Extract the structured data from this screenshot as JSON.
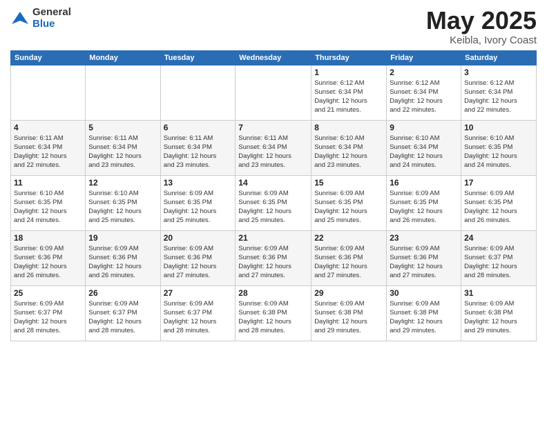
{
  "logo": {
    "general": "General",
    "blue": "Blue"
  },
  "header": {
    "month": "May 2025",
    "location": "Keibla, Ivory Coast"
  },
  "weekdays": [
    "Sunday",
    "Monday",
    "Tuesday",
    "Wednesday",
    "Thursday",
    "Friday",
    "Saturday"
  ],
  "weeks": [
    [
      {
        "day": "",
        "info": ""
      },
      {
        "day": "",
        "info": ""
      },
      {
        "day": "",
        "info": ""
      },
      {
        "day": "",
        "info": ""
      },
      {
        "day": "1",
        "info": "Sunrise: 6:12 AM\nSunset: 6:34 PM\nDaylight: 12 hours\nand 21 minutes."
      },
      {
        "day": "2",
        "info": "Sunrise: 6:12 AM\nSunset: 6:34 PM\nDaylight: 12 hours\nand 22 minutes."
      },
      {
        "day": "3",
        "info": "Sunrise: 6:12 AM\nSunset: 6:34 PM\nDaylight: 12 hours\nand 22 minutes."
      }
    ],
    [
      {
        "day": "4",
        "info": "Sunrise: 6:11 AM\nSunset: 6:34 PM\nDaylight: 12 hours\nand 22 minutes."
      },
      {
        "day": "5",
        "info": "Sunrise: 6:11 AM\nSunset: 6:34 PM\nDaylight: 12 hours\nand 23 minutes."
      },
      {
        "day": "6",
        "info": "Sunrise: 6:11 AM\nSunset: 6:34 PM\nDaylight: 12 hours\nand 23 minutes."
      },
      {
        "day": "7",
        "info": "Sunrise: 6:11 AM\nSunset: 6:34 PM\nDaylight: 12 hours\nand 23 minutes."
      },
      {
        "day": "8",
        "info": "Sunrise: 6:10 AM\nSunset: 6:34 PM\nDaylight: 12 hours\nand 23 minutes."
      },
      {
        "day": "9",
        "info": "Sunrise: 6:10 AM\nSunset: 6:34 PM\nDaylight: 12 hours\nand 24 minutes."
      },
      {
        "day": "10",
        "info": "Sunrise: 6:10 AM\nSunset: 6:35 PM\nDaylight: 12 hours\nand 24 minutes."
      }
    ],
    [
      {
        "day": "11",
        "info": "Sunrise: 6:10 AM\nSunset: 6:35 PM\nDaylight: 12 hours\nand 24 minutes."
      },
      {
        "day": "12",
        "info": "Sunrise: 6:10 AM\nSunset: 6:35 PM\nDaylight: 12 hours\nand 25 minutes."
      },
      {
        "day": "13",
        "info": "Sunrise: 6:09 AM\nSunset: 6:35 PM\nDaylight: 12 hours\nand 25 minutes."
      },
      {
        "day": "14",
        "info": "Sunrise: 6:09 AM\nSunset: 6:35 PM\nDaylight: 12 hours\nand 25 minutes."
      },
      {
        "day": "15",
        "info": "Sunrise: 6:09 AM\nSunset: 6:35 PM\nDaylight: 12 hours\nand 25 minutes."
      },
      {
        "day": "16",
        "info": "Sunrise: 6:09 AM\nSunset: 6:35 PM\nDaylight: 12 hours\nand 26 minutes."
      },
      {
        "day": "17",
        "info": "Sunrise: 6:09 AM\nSunset: 6:35 PM\nDaylight: 12 hours\nand 26 minutes."
      }
    ],
    [
      {
        "day": "18",
        "info": "Sunrise: 6:09 AM\nSunset: 6:36 PM\nDaylight: 12 hours\nand 26 minutes."
      },
      {
        "day": "19",
        "info": "Sunrise: 6:09 AM\nSunset: 6:36 PM\nDaylight: 12 hours\nand 26 minutes."
      },
      {
        "day": "20",
        "info": "Sunrise: 6:09 AM\nSunset: 6:36 PM\nDaylight: 12 hours\nand 27 minutes."
      },
      {
        "day": "21",
        "info": "Sunrise: 6:09 AM\nSunset: 6:36 PM\nDaylight: 12 hours\nand 27 minutes."
      },
      {
        "day": "22",
        "info": "Sunrise: 6:09 AM\nSunset: 6:36 PM\nDaylight: 12 hours\nand 27 minutes."
      },
      {
        "day": "23",
        "info": "Sunrise: 6:09 AM\nSunset: 6:36 PM\nDaylight: 12 hours\nand 27 minutes."
      },
      {
        "day": "24",
        "info": "Sunrise: 6:09 AM\nSunset: 6:37 PM\nDaylight: 12 hours\nand 28 minutes."
      }
    ],
    [
      {
        "day": "25",
        "info": "Sunrise: 6:09 AM\nSunset: 6:37 PM\nDaylight: 12 hours\nand 28 minutes."
      },
      {
        "day": "26",
        "info": "Sunrise: 6:09 AM\nSunset: 6:37 PM\nDaylight: 12 hours\nand 28 minutes."
      },
      {
        "day": "27",
        "info": "Sunrise: 6:09 AM\nSunset: 6:37 PM\nDaylight: 12 hours\nand 28 minutes."
      },
      {
        "day": "28",
        "info": "Sunrise: 6:09 AM\nSunset: 6:38 PM\nDaylight: 12 hours\nand 28 minutes."
      },
      {
        "day": "29",
        "info": "Sunrise: 6:09 AM\nSunset: 6:38 PM\nDaylight: 12 hours\nand 29 minutes."
      },
      {
        "day": "30",
        "info": "Sunrise: 6:09 AM\nSunset: 6:38 PM\nDaylight: 12 hours\nand 29 minutes."
      },
      {
        "day": "31",
        "info": "Sunrise: 6:09 AM\nSunset: 6:38 PM\nDaylight: 12 hours\nand 29 minutes."
      }
    ]
  ]
}
